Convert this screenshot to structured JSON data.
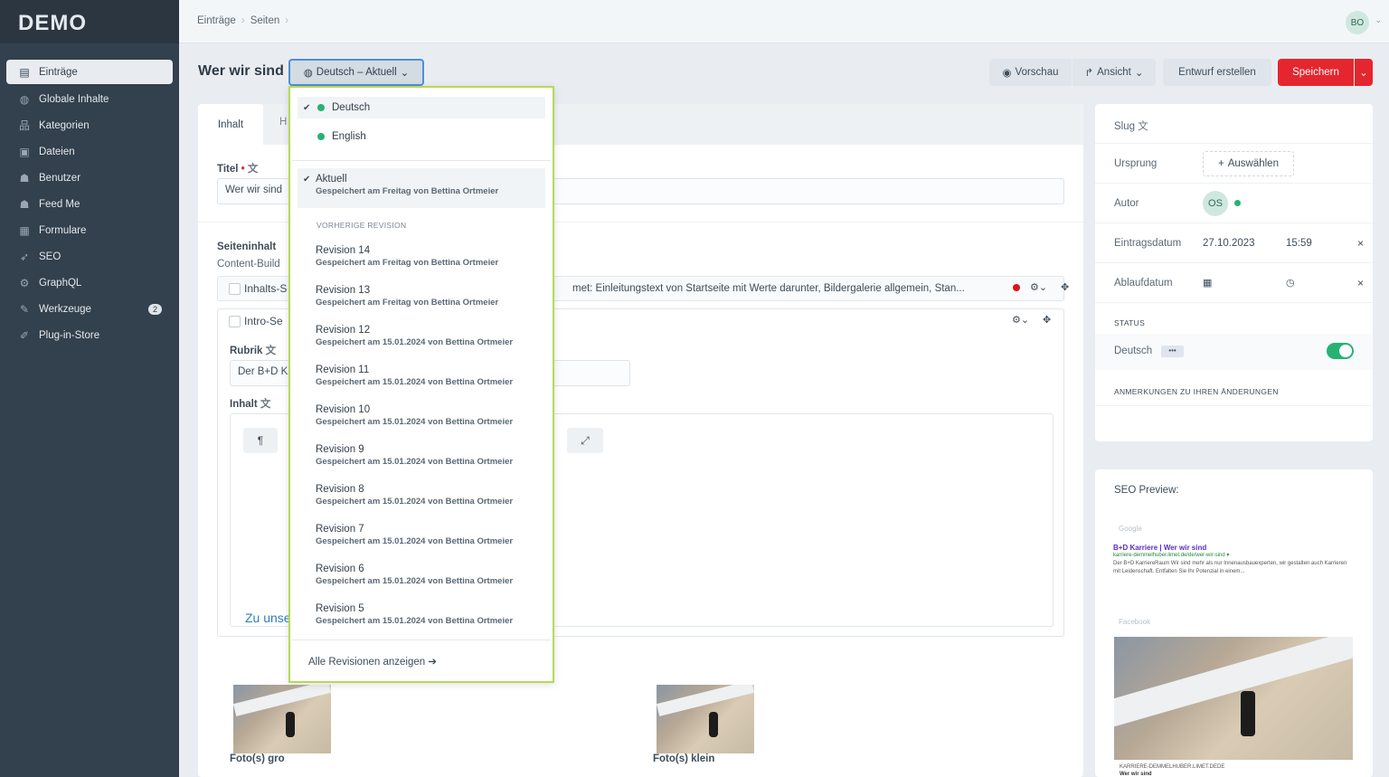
{
  "app": {
    "logo": "DEMO"
  },
  "sidebar": {
    "items": [
      {
        "label": "Einträge",
        "icon": "entries-icon",
        "glyph": "▤",
        "active": true
      },
      {
        "label": "Globale Inhalte",
        "icon": "globe-icon",
        "glyph": "◍"
      },
      {
        "label": "Kategorien",
        "icon": "sitemap-icon",
        "glyph": "品"
      },
      {
        "label": "Dateien",
        "icon": "image-icon",
        "glyph": "▣"
      },
      {
        "label": "Benutzer",
        "icon": "users-icon",
        "glyph": "☗"
      },
      {
        "label": "Feed Me",
        "icon": "feedme-icon",
        "glyph": "☗"
      },
      {
        "label": "Formulare",
        "icon": "form-icon",
        "glyph": "▦"
      },
      {
        "label": "SEO",
        "icon": "seo-icon",
        "glyph": "➶"
      },
      {
        "label": "GraphQL",
        "icon": "graphql-icon",
        "glyph": "⚙"
      },
      {
        "label": "Werkzeuge",
        "icon": "wrench-icon",
        "glyph": "✎",
        "badge": "2"
      },
      {
        "label": "Plug-in-Store",
        "icon": "plug-icon",
        "glyph": "✐"
      }
    ]
  },
  "topbar": {
    "breadcrumb": [
      "Einträge",
      "Seiten"
    ],
    "user_initials": "BO"
  },
  "header": {
    "title": "Wer wir sind",
    "lang_button": "Deutsch – Aktuell",
    "preview": "Vorschau",
    "view": "Ansicht",
    "draft": "Entwurf erstellen",
    "save": "Speichern"
  },
  "tabs": {
    "active": "Inhalt",
    "second": "H"
  },
  "form": {
    "title_label": "Titel",
    "title_value": "Wer wir sind",
    "content_label": "Seiteninhalt",
    "content_sub": "Content-Build",
    "block1_label": "Inhalts-S",
    "block1_summary": "met: Einleitungstext von Startseite mit Werte darunter, Bildergalerie allgemein, Stan...",
    "block2_label": "Intro-Se",
    "rubrik_label": "Rubrik",
    "rubrik_value": "Der B+D K",
    "inhalt_label": "Inhalt",
    "link_text": "Zu unse",
    "photos_big_label": "Foto(s) gro",
    "photos_small_label": "Foto(s) klein"
  },
  "dropdown": {
    "languages": [
      {
        "label": "Deutsch",
        "selected": true
      },
      {
        "label": "English",
        "selected": false
      }
    ],
    "current": {
      "label": "Aktuell",
      "meta": "Gespeichert am Freitag von Bettina Ortmeier"
    },
    "prev_heading": "VORHERIGE REVISION",
    "revisions": [
      {
        "label": "Revision 14",
        "meta": "Gespeichert am Freitag von Bettina Ortmeier"
      },
      {
        "label": "Revision 13",
        "meta": "Gespeichert am Freitag von Bettina Ortmeier"
      },
      {
        "label": "Revision 12",
        "meta": "Gespeichert am 15.01.2024 von Bettina Ortmeier"
      },
      {
        "label": "Revision 11",
        "meta": "Gespeichert am 15.01.2024 von Bettina Ortmeier"
      },
      {
        "label": "Revision 10",
        "meta": "Gespeichert am 15.01.2024 von Bettina Ortmeier"
      },
      {
        "label": "Revision 9",
        "meta": "Gespeichert am 15.01.2024 von Bettina Ortmeier"
      },
      {
        "label": "Revision 8",
        "meta": "Gespeichert am 15.01.2024 von Bettina Ortmeier"
      },
      {
        "label": "Revision 7",
        "meta": "Gespeichert am 15.01.2024 von Bettina Ortmeier"
      },
      {
        "label": "Revision 6",
        "meta": "Gespeichert am 15.01.2024 von Bettina Ortmeier"
      },
      {
        "label": "Revision 5",
        "meta": "Gespeichert am 15.01.2024 von Bettina Ortmeier"
      }
    ],
    "show_all": "Alle Revisionen anzeigen"
  },
  "meta": {
    "slug": "Slug",
    "origin": "Ursprung",
    "choose": "Auswählen",
    "author": "Autor",
    "author_initials": "OS",
    "post_date_label": "Eintragsdatum",
    "post_date": "27.10.2023",
    "post_time": "15:59",
    "expiry_label": "Ablaufdatum",
    "status_heading": "STATUS",
    "status_lang": "Deutsch",
    "status_enabled": true,
    "notes_heading": "ANMERKUNGEN ZU IHREN ÄNDERUNGEN"
  },
  "seo": {
    "heading": "SEO Preview:",
    "google": "Google",
    "title": "B+D Karriere | Wer wir sind",
    "url": "karriere-demmelhuber.limet.de/de/wer-wir-sind ▾",
    "desc": "Der B+D KarriereRaum Wir sind mehr als nur Innenausbauexperten, wir gestalten auch Karrieren mit Leidenschaft. Entfalten Sie Ihr Potenzial in einem...",
    "facebook": "Facebook",
    "fb_url": "KARRIERE-DEMMELHUBER.LIMET.DEDE",
    "fb_title": "Wer wir sind"
  },
  "colors": {
    "accent": "#e5262e",
    "sidebar": "#33404d",
    "status_green": "#27b273",
    "dropdown_border": "#b6d957"
  }
}
